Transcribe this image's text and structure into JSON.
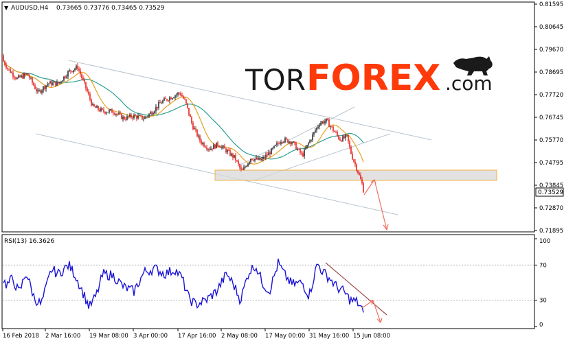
{
  "header": {
    "symbol_timeframe": "AUDUSD,H4",
    "ohlc": "0.73665 0.73776 0.73465 0.73529"
  },
  "logo": {
    "prefix": "TOR",
    "brand": "FOREX",
    "suffix": ".com"
  },
  "colors": {
    "bull": "#2b2b2b",
    "bear": "#e8201c",
    "ma_fast": "#e6a020",
    "ma_slow": "#2aa090",
    "channel": "#b8c4d0",
    "rsi": "#1a12d6",
    "trend_arrow": "#f07060",
    "zone_fill": "#d8d8d8",
    "zone_border": "#f0b040",
    "logo_dark": "#1a1a1a",
    "logo_accent": "#ff3a0a"
  },
  "chart_data": [
    {
      "type": "candlestick",
      "title": "AUDUSD,H4",
      "ylim": [
        0.71895,
        0.81595
      ],
      "y_ticks": [
        "0.81595",
        "0.80645",
        "0.79670",
        "0.78695",
        "0.77720",
        "0.76745",
        "0.75770",
        "0.74795",
        "0.73845",
        "0.72870",
        "0.71895"
      ],
      "x_ticks": [
        "16 Feb 2018",
        "2 Mar 16:00",
        "19 Mar 08:00",
        "3 Apr 00:00",
        "17 Apr 16:00",
        "2 May 08:00",
        "17 May 00:00",
        "31 May 16:00",
        "15 Jun 08:00"
      ],
      "current_price": "0.73529",
      "series": [
        {
          "name": "close",
          "anchors": [
            [
              0,
              0.794
            ],
            [
              12,
              0.788
            ],
            [
              25,
              0.784
            ],
            [
              40,
              0.786
            ],
            [
              55,
              0.778
            ],
            [
              70,
              0.782
            ],
            [
              85,
              0.782
            ],
            [
              100,
              0.787
            ],
            [
              113,
              0.789
            ],
            [
              125,
              0.78
            ],
            [
              135,
              0.772
            ],
            [
              150,
              0.77
            ],
            [
              165,
              0.77
            ],
            [
              180,
              0.767
            ],
            [
              195,
              0.768
            ],
            [
              210,
              0.767
            ],
            [
              222,
              0.77
            ],
            [
              235,
              0.774
            ],
            [
              248,
              0.776
            ],
            [
              262,
              0.778
            ],
            [
              270,
              0.774
            ],
            [
              280,
              0.764
            ],
            [
              292,
              0.757
            ],
            [
              305,
              0.754
            ],
            [
              318,
              0.756
            ],
            [
              330,
              0.753
            ],
            [
              342,
              0.75
            ],
            [
              352,
              0.744
            ],
            [
              365,
              0.75
            ],
            [
              380,
              0.749
            ],
            [
              395,
              0.753
            ],
            [
              410,
              0.758
            ],
            [
              425,
              0.757
            ],
            [
              440,
              0.751
            ],
            [
              452,
              0.758
            ],
            [
              465,
              0.765
            ],
            [
              475,
              0.766
            ],
            [
              485,
              0.762
            ],
            [
              495,
              0.758
            ],
            [
              505,
              0.759
            ],
            [
              512,
              0.751
            ],
            [
              520,
              0.745
            ],
            [
              528,
              0.738
            ],
            [
              530,
              0.7353
            ]
          ]
        }
      ]
    },
    {
      "type": "line",
      "title": "RSI(13) 16.3626",
      "ylim": [
        0,
        100
      ],
      "y_ticks": [
        "100",
        "70",
        "30",
        "0"
      ],
      "levels": [
        70,
        30
      ],
      "series": [
        {
          "name": "RSI(13)",
          "anchors": [
            [
              0,
              0.58
            ],
            [
              10,
              0.47
            ],
            [
              18,
              0.55
            ],
            [
              28,
              0.38
            ],
            [
              38,
              0.62
            ],
            [
              50,
              0.32
            ],
            [
              60,
              0.25
            ],
            [
              75,
              0.65
            ],
            [
              85,
              0.6
            ],
            [
              100,
              0.7
            ],
            [
              110,
              0.58
            ],
            [
              120,
              0.4
            ],
            [
              130,
              0.22
            ],
            [
              140,
              0.35
            ],
            [
              150,
              0.6
            ],
            [
              165,
              0.58
            ],
            [
              180,
              0.45
            ],
            [
              195,
              0.4
            ],
            [
              210,
              0.62
            ],
            [
              225,
              0.66
            ],
            [
              240,
              0.6
            ],
            [
              255,
              0.65
            ],
            [
              265,
              0.55
            ],
            [
              275,
              0.32
            ],
            [
              285,
              0.25
            ],
            [
              300,
              0.3
            ],
            [
              315,
              0.4
            ],
            [
              330,
              0.6
            ],
            [
              340,
              0.48
            ],
            [
              350,
              0.3
            ],
            [
              362,
              0.62
            ],
            [
              372,
              0.7
            ],
            [
              382,
              0.5
            ],
            [
              392,
              0.4
            ],
            [
              405,
              0.72
            ],
            [
              415,
              0.58
            ],
            [
              425,
              0.48
            ],
            [
              440,
              0.5
            ],
            [
              450,
              0.35
            ],
            [
              462,
              0.72
            ],
            [
              470,
              0.62
            ],
            [
              480,
              0.55
            ],
            [
              490,
              0.45
            ],
            [
              500,
              0.4
            ],
            [
              510,
              0.3
            ],
            [
              520,
              0.28
            ],
            [
              530,
              0.16
            ]
          ]
        }
      ]
    }
  ]
}
